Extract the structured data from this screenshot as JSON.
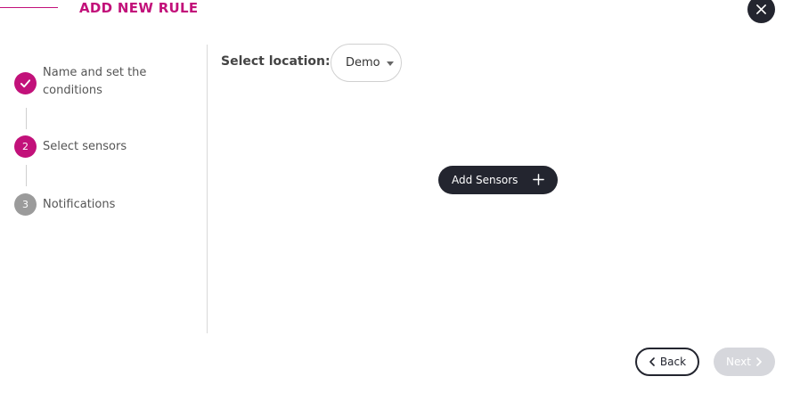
{
  "header": {
    "title": "ADD NEW RULE"
  },
  "steps": [
    {
      "number": "",
      "label": "Name and set the conditions",
      "state": "completed"
    },
    {
      "number": "2",
      "label": "Select sensors",
      "state": "active"
    },
    {
      "number": "3",
      "label": "Notifications",
      "state": "pending"
    }
  ],
  "location": {
    "label": "Select location:",
    "value": "Demo"
  },
  "main": {
    "add_sensors_label": "Add Sensors"
  },
  "footer": {
    "back_label": "Back",
    "next_label": "Next"
  },
  "colors": {
    "accent": "#c2117a",
    "dark": "#23252f",
    "pending": "#9b9b9b",
    "disabled": "#d6d7dc"
  }
}
